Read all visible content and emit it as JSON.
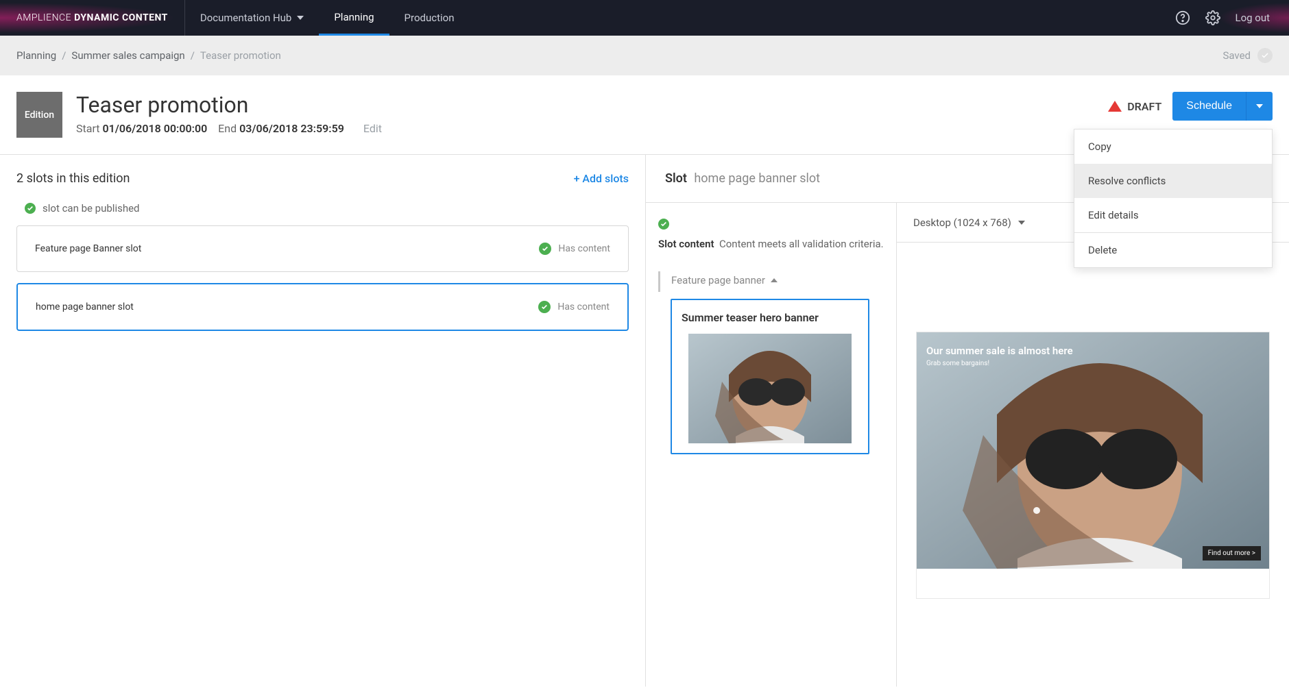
{
  "brand": {
    "part1": "AMPLIENCE",
    "part2": "DYNAMIC CONTENT"
  },
  "topnav": {
    "doc_hub": "Documentation Hub",
    "planning": "Planning",
    "production": "Production",
    "logout": "Log out"
  },
  "breadcrumb": {
    "root": "Planning",
    "campaign": "Summer sales campaign",
    "current": "Teaser promotion",
    "saved": "Saved"
  },
  "edition": {
    "chip": "Edition",
    "title": "Teaser promotion",
    "start_label": "Start",
    "start_value": "01/06/2018 00:00:00",
    "end_label": "End",
    "end_value": "03/06/2018 23:59:59",
    "edit": "Edit",
    "status": "DRAFT",
    "schedule": "Schedule"
  },
  "dropdown": {
    "copy": "Copy",
    "resolve": "Resolve conflicts",
    "edit_details": "Edit details",
    "delete": "Delete"
  },
  "slots": {
    "heading": "2 slots in this edition",
    "add": "+ Add slots",
    "pub_note": "slot can be published",
    "items": [
      {
        "name": "Feature page Banner slot",
        "status": "Has content"
      },
      {
        "name": "home page banner slot",
        "status": "Has content"
      }
    ]
  },
  "slot_panel": {
    "label": "Slot",
    "name": "home page banner slot",
    "content_label": "Slot content",
    "validation_msg": "Content meets all validation criteria.",
    "feature_label": "Feature page banner",
    "card_title": "Summer teaser hero banner"
  },
  "preview": {
    "viewport": "Desktop (1024 x 768)",
    "hero_title": "Our summer sale is almost here",
    "hero_sub": "Grab some bargains!",
    "cta": "Find out more >"
  }
}
